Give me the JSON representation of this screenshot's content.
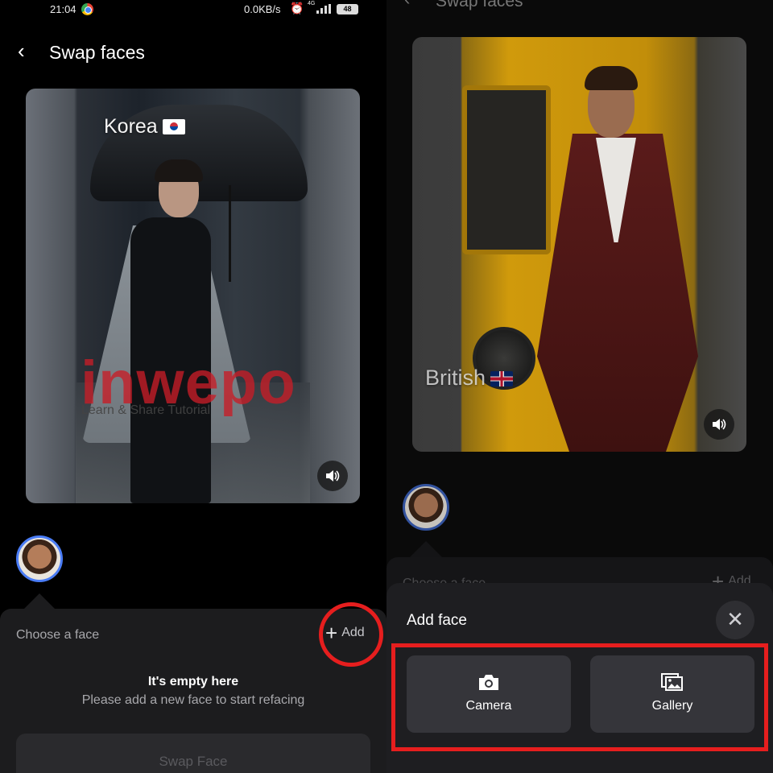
{
  "left": {
    "status": {
      "time": "21:04",
      "speed": "0.0KB/s",
      "network": "4G",
      "battery": "48"
    },
    "header": {
      "title": "Swap faces"
    },
    "video": {
      "label": "Korea",
      "flag": "🇰🇷",
      "watermark": "inwepo",
      "watermark_sub": "Learn & Share Tutorial"
    },
    "sheet": {
      "label": "Choose a face",
      "add": "Add",
      "empty_title": "It's empty here",
      "empty_sub": "Please add a new face to start refacing",
      "swap_button": "Swap Face"
    }
  },
  "right": {
    "header": {
      "title": "Swap faces"
    },
    "video": {
      "label": "British",
      "flag": "🇬🇧"
    },
    "sheet": {
      "label": "Choose a face",
      "add": "Add"
    },
    "add_face": {
      "title": "Add face",
      "options": [
        {
          "label": "Camera",
          "icon": "camera-icon"
        },
        {
          "label": "Gallery",
          "icon": "gallery-icon"
        }
      ]
    }
  },
  "colors": {
    "highlight": "#e61e1e",
    "avatar_border": "#4a7cf5",
    "background": "#000000",
    "sheet": "#1c1c1e"
  }
}
